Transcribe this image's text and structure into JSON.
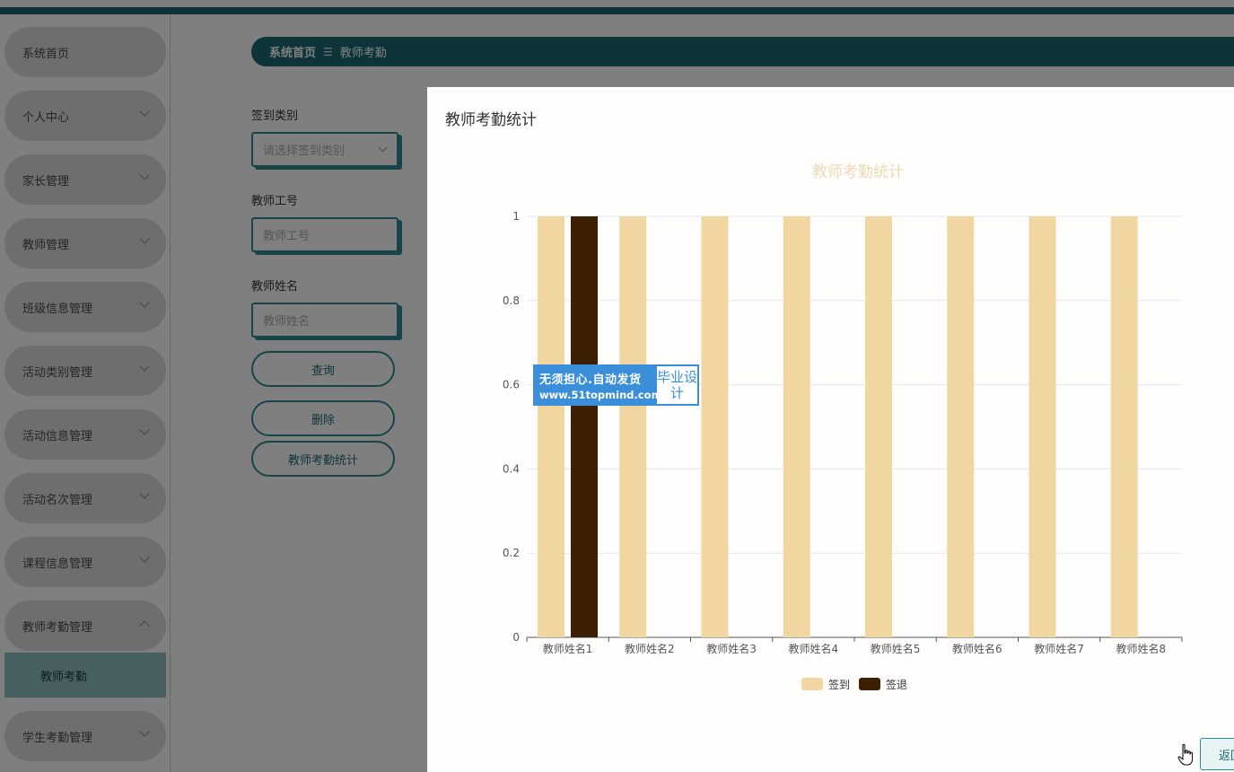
{
  "sidebar": {
    "items": [
      {
        "label": "系统首页",
        "has_chevron": false
      },
      {
        "label": "个人中心",
        "has_chevron": true
      },
      {
        "label": "家长管理",
        "has_chevron": true
      },
      {
        "label": "教师管理",
        "has_chevron": true
      },
      {
        "label": "班级信息管理",
        "has_chevron": true
      },
      {
        "label": "活动类别管理",
        "has_chevron": true
      },
      {
        "label": "活动信息管理",
        "has_chevron": true
      },
      {
        "label": "活动名次管理",
        "has_chevron": true
      },
      {
        "label": "课程信息管理",
        "has_chevron": true
      },
      {
        "label": "教师考勤管理",
        "has_chevron": true,
        "expanded": true
      },
      {
        "label": "学生考勤管理",
        "has_chevron": true
      }
    ],
    "active_sub_item": "教师考勤"
  },
  "breadcrumb": {
    "home": "系统首页",
    "separator": "☰",
    "current": "教师考勤"
  },
  "search_form": {
    "sign_type_label": "签到类别",
    "sign_type_placeholder": "请选择签到类别",
    "teacher_id_label": "教师工号",
    "teacher_id_placeholder": "教师工号",
    "teacher_name_label": "教师姓名",
    "teacher_name_placeholder": "教师姓名",
    "query_button": "查询",
    "delete_button": "删除",
    "stats_button": "教师考勤统计"
  },
  "dialog": {
    "title": "教师考勤统计",
    "return_button": "返回"
  },
  "watermark": {
    "line1": "无须担心.自动发货",
    "line2": "www.51topmind.com",
    "right": "毕业设计"
  },
  "colors": {
    "primary": "#1b6b72",
    "accent_border": "#2a8b91",
    "series_checkin": "#f2d6a2",
    "series_checkout": "#3d1f03",
    "chart_title": "#ecd9b4",
    "watermark_blue": "#3a8fd8"
  },
  "chart_data": {
    "type": "bar",
    "title": "教师考勤统计",
    "categories": [
      "教师姓名1",
      "教师姓名2",
      "教师姓名3",
      "教师姓名4",
      "教师姓名5",
      "教师姓名6",
      "教师姓名7",
      "教师姓名8"
    ],
    "series": [
      {
        "name": "签到",
        "values": [
          1,
          1,
          1,
          1,
          1,
          1,
          1,
          1
        ]
      },
      {
        "name": "签退",
        "values": [
          1,
          0,
          0,
          0,
          0,
          0,
          0,
          0
        ]
      }
    ],
    "yticks": [
      "0",
      "0.2",
      "0.4",
      "0.6",
      "0.8",
      "1"
    ],
    "ylim": [
      0,
      1
    ],
    "grid": true,
    "legend_position": "bottom-center"
  }
}
